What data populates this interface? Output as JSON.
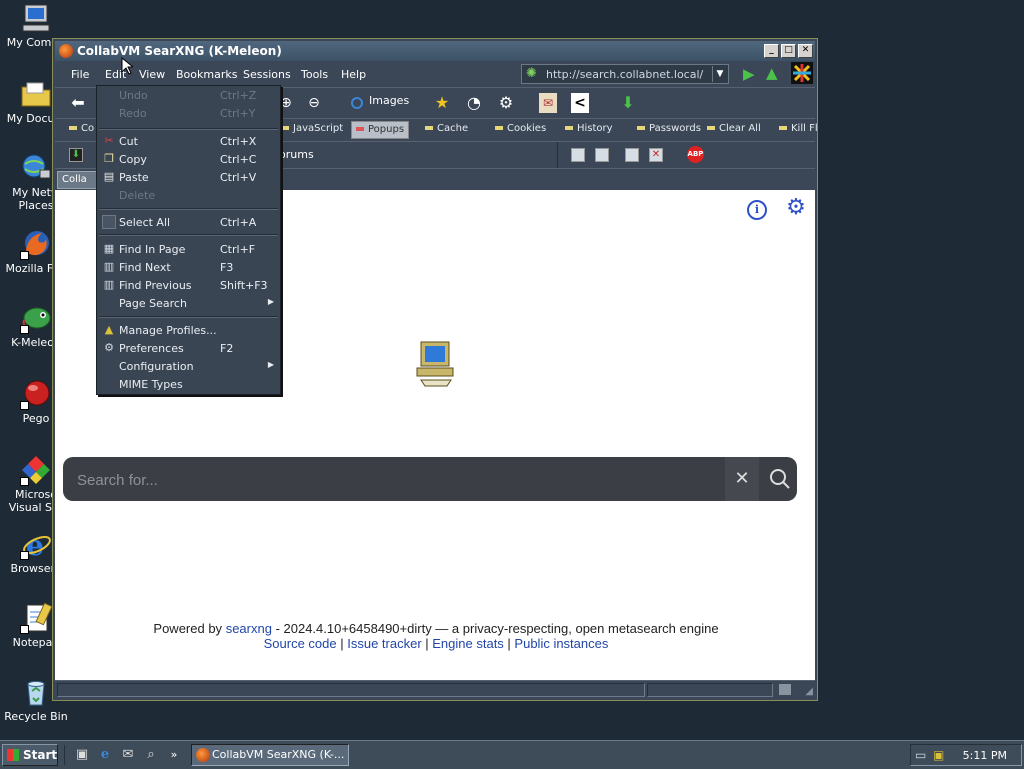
{
  "desktop": {
    "icons": [
      {
        "label": "My Compu",
        "icon": "computer-icon"
      },
      {
        "label": "My Docum",
        "icon": "folder-icon"
      },
      {
        "label": "My Netw\nPlaces",
        "icon": "network-icon"
      },
      {
        "label": "Mozilla Fire",
        "icon": "firefox-icon"
      },
      {
        "label": "K-Meleon",
        "icon": "chameleon-icon"
      },
      {
        "label": "Pego",
        "icon": "pego-icon"
      },
      {
        "label": "Microso\nVisual Stu",
        "icon": "visual-studio-icon"
      },
      {
        "label": "Browserv",
        "icon": "internet-explorer-icon"
      },
      {
        "label": "Notepad",
        "icon": "notepad-icon"
      },
      {
        "label": "Recycle Bin",
        "icon": "recycle-bin-icon"
      }
    ]
  },
  "window": {
    "title": "CollabVM SearXNG (K-Meleon)",
    "menu": [
      "File",
      "Edit",
      "View",
      "Bookmarks",
      "Sessions",
      "Tools",
      "Help"
    ],
    "url": "http://search.collabnet.local/",
    "images_label": "Images",
    "toggles": [
      "Co",
      "JavaScript",
      "Popups",
      "Cache",
      "Cookies",
      "History",
      "Passwords",
      "Clear All",
      "Kill Fl"
    ],
    "links_label": "orums",
    "tab_label": "Colla",
    "abp_label": "ABP"
  },
  "edit_menu": [
    {
      "label": "Undo",
      "key": "Ctrl+Z",
      "disabled": true,
      "icon": ""
    },
    {
      "label": "Redo",
      "key": "Ctrl+Y",
      "disabled": true,
      "icon": ""
    },
    {
      "label": "Cut",
      "key": "Ctrl+X",
      "disabled": false,
      "icon": "scissors-icon"
    },
    {
      "label": "Copy",
      "key": "Ctrl+C",
      "disabled": false,
      "icon": "copy-icon"
    },
    {
      "label": "Paste",
      "key": "Ctrl+V",
      "disabled": false,
      "icon": "paste-icon"
    },
    {
      "label": "Delete",
      "key": "",
      "disabled": true,
      "icon": ""
    },
    {
      "label": "Select All",
      "key": "Ctrl+A",
      "disabled": false,
      "icon": "select-all-icon"
    },
    {
      "label": "Find In Page",
      "key": "Ctrl+F",
      "disabled": false,
      "icon": "find-icon"
    },
    {
      "label": "Find Next",
      "key": "F3",
      "disabled": false,
      "icon": "find-next-icon"
    },
    {
      "label": "Find Previous",
      "key": "Shift+F3",
      "disabled": false,
      "icon": "find-previous-icon"
    },
    {
      "label": "Page Search",
      "key": "",
      "disabled": false,
      "icon": "",
      "submenu": true
    },
    {
      "label": "Manage Profiles...",
      "key": "",
      "disabled": false,
      "icon": "profiles-icon"
    },
    {
      "label": "Preferences",
      "key": "F2",
      "disabled": false,
      "icon": "gear-icon"
    },
    {
      "label": "Configuration",
      "key": "",
      "disabled": false,
      "icon": "",
      "submenu": true
    },
    {
      "label": "MIME Types",
      "key": "",
      "disabled": false,
      "icon": ""
    }
  ],
  "page": {
    "search_placeholder": "Search for...",
    "powered_prefix": "Powered by",
    "powered_link": "searxng",
    "powered_suffix": "- 2024.4.10+6458490+dirty — a privacy-respecting, open metasearch engine",
    "links": [
      "Source code",
      "Issue tracker",
      "Engine stats",
      "Public instances"
    ]
  },
  "taskbar": {
    "start_label": "Start",
    "task_label": "CollabVM SearXNG (K-...",
    "clock": "5:11 PM"
  },
  "colors": {
    "accent_blue": "#3050c8",
    "link_blue": "#2246a8",
    "search_bg": "#3b3f45"
  }
}
